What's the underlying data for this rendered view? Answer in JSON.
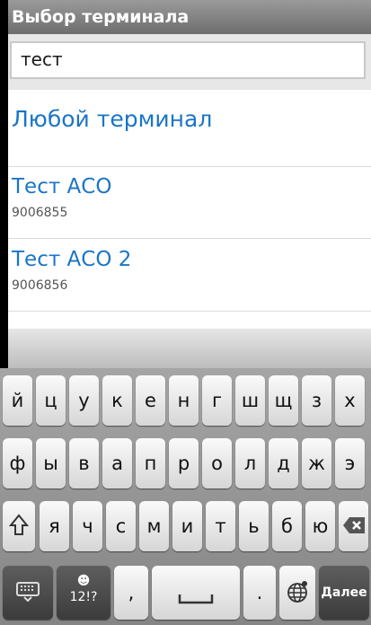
{
  "dialog": {
    "title": "Выбор терминала"
  },
  "search": {
    "value": "тест"
  },
  "list": {
    "any_label": "Любой терминал",
    "items": [
      {
        "name": "Тест АСО",
        "number": "9006855"
      },
      {
        "name": "Тест АСО 2",
        "number": "9006856"
      }
    ]
  },
  "keyboard": {
    "row1": [
      "й",
      "ц",
      "у",
      "к",
      "е",
      "н",
      "г",
      "ш",
      "щ",
      "з",
      "х"
    ],
    "row2": [
      "ф",
      "ы",
      "в",
      "а",
      "п",
      "р",
      "о",
      "л",
      "д",
      "ж",
      "э"
    ],
    "row3": [
      "я",
      "ч",
      "с",
      "м",
      "и",
      "т",
      "ь",
      "б",
      "ю"
    ],
    "symbols_label": "12!?",
    "comma": ",",
    "period": ".",
    "enter_label": "Далее",
    "icons": {
      "shift": "shift-icon",
      "backspace": "backspace-icon",
      "keyboard": "keyboard-icon",
      "smiley": "smiley-icon",
      "space": "spacebar-icon",
      "globe": "globe-icon"
    }
  }
}
